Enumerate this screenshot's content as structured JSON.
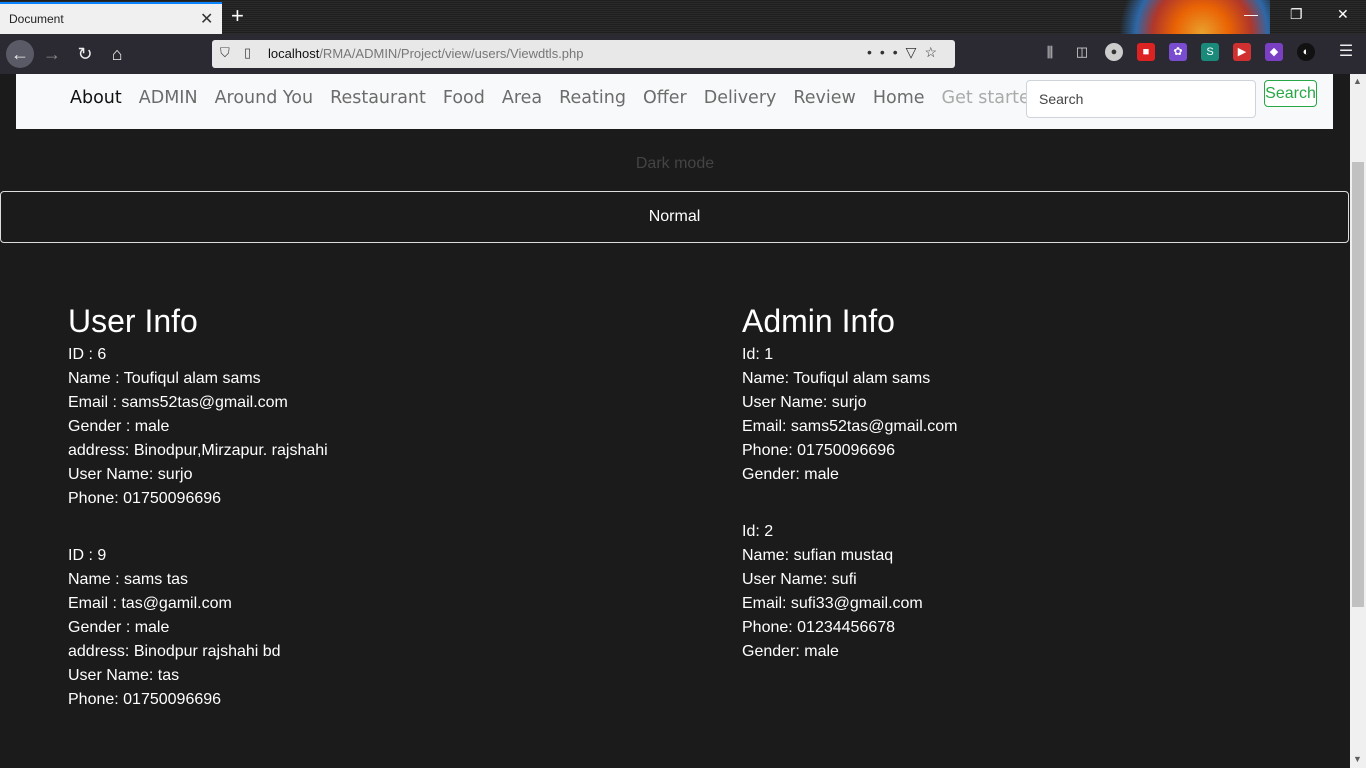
{
  "browser": {
    "tab_title": "Document",
    "url_host": "localhost",
    "url_path": "/RMA/ADMIN/Project/view/users/Viewdtls.php"
  },
  "navbar": {
    "links": [
      "About",
      "ADMIN",
      "Around You",
      "Restaurant",
      "Food",
      "Area",
      "Reating",
      "Offer",
      "Delivery",
      "Review",
      "Home",
      "Get started"
    ],
    "search_placeholder": "Search",
    "search_button": "Search"
  },
  "mode": {
    "dark_label": "Dark mode",
    "normal_label": "Normal"
  },
  "user_info": {
    "heading": "User Info",
    "records": [
      [
        "ID : 6",
        "Name : Toufiqul alam sams",
        "Email : sams52tas@gmail.com",
        "Gender : male",
        "address: Binodpur,Mirzapur. rajshahi",
        "User Name: surjo",
        "Phone: 01750096696"
      ],
      [
        "ID : 9",
        "Name : sams tas",
        "Email : tas@gamil.com",
        "Gender : male",
        "address: Binodpur rajshahi bd",
        "User Name: tas",
        "Phone: 01750096696"
      ]
    ]
  },
  "admin_info": {
    "heading": "Admin Info",
    "records": [
      [
        "Id: 1",
        "Name: Toufiqul alam sams",
        "User Name: surjo",
        "Email: sams52tas@gmail.com",
        "Phone: 01750096696",
        "Gender: male"
      ],
      [
        "Id: 2",
        "Name: sufian mustaq",
        "User Name: sufi",
        "Email: sufi33@gmail.com",
        "Phone: 01234456678",
        "Gender: male"
      ]
    ]
  }
}
